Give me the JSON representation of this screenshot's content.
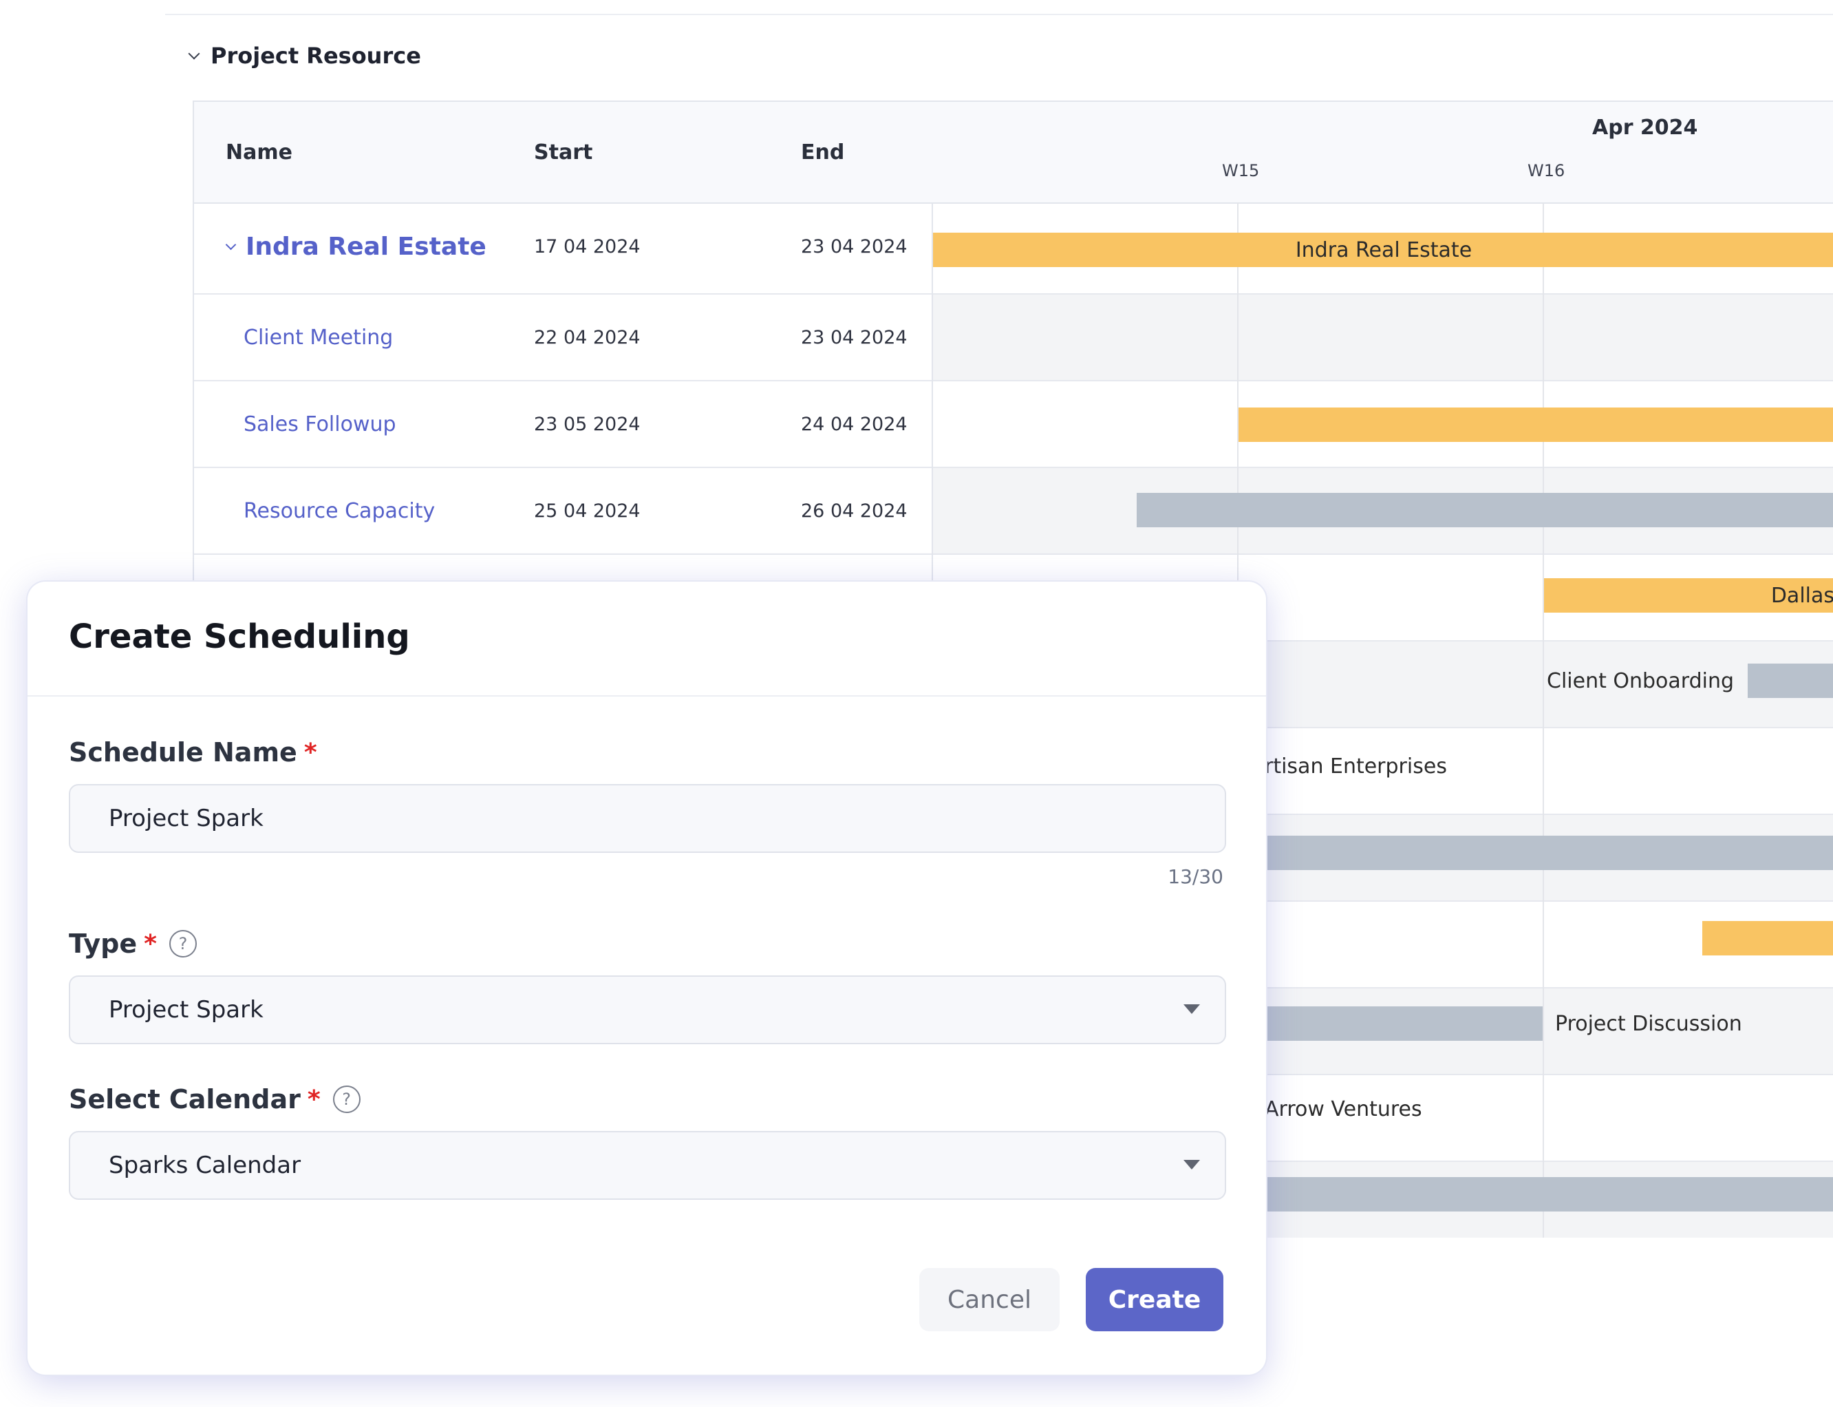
{
  "section": {
    "title": "Project Resource"
  },
  "gantt": {
    "columns": {
      "name": "Name",
      "start": "Start",
      "end": "End"
    },
    "month": "Apr 2024",
    "weeks": [
      "W15",
      "W16"
    ],
    "rows": [
      {
        "name": "Indra Real Estate",
        "start": "17 04 2024",
        "end": "23 04 2024"
      },
      {
        "name": "Client Meeting",
        "start": "22 04 2024",
        "end": "23 04 2024"
      },
      {
        "name": "Sales Followup",
        "start": "23 05 2024",
        "end": "24 04 2024"
      },
      {
        "name": "Resource Capacity",
        "start": "25 04 2024",
        "end": "26 04 2024"
      }
    ],
    "bar_labels": {
      "indra": "Indra Real Estate",
      "dallas": "Dallas",
      "client_onboarding": "Client Onboarding",
      "artisan": "rtisan Enterprises",
      "project_discussion": "Project Discussion",
      "arrow": "Arrow Ventures"
    },
    "colors": {
      "task_bar": "#f9c463",
      "resource_bar": "#b8c1cc",
      "link": "#5561c9"
    }
  },
  "dialog": {
    "title": "Create Scheduling",
    "schedule_name": {
      "label": "Schedule Name",
      "required_mark": "*",
      "value": "Project Spark",
      "counter": "13/30"
    },
    "type": {
      "label": "Type",
      "required_mark": "*",
      "help_icon": "?",
      "value": "Project Spark"
    },
    "calendar": {
      "label": "Select Calendar",
      "required_mark": "*",
      "help_icon": "?",
      "value": "Sparks Calendar"
    },
    "buttons": {
      "cancel": "Cancel",
      "create": "Create"
    },
    "colors": {
      "primary": "#5c66c8",
      "required": "#e02424"
    }
  }
}
